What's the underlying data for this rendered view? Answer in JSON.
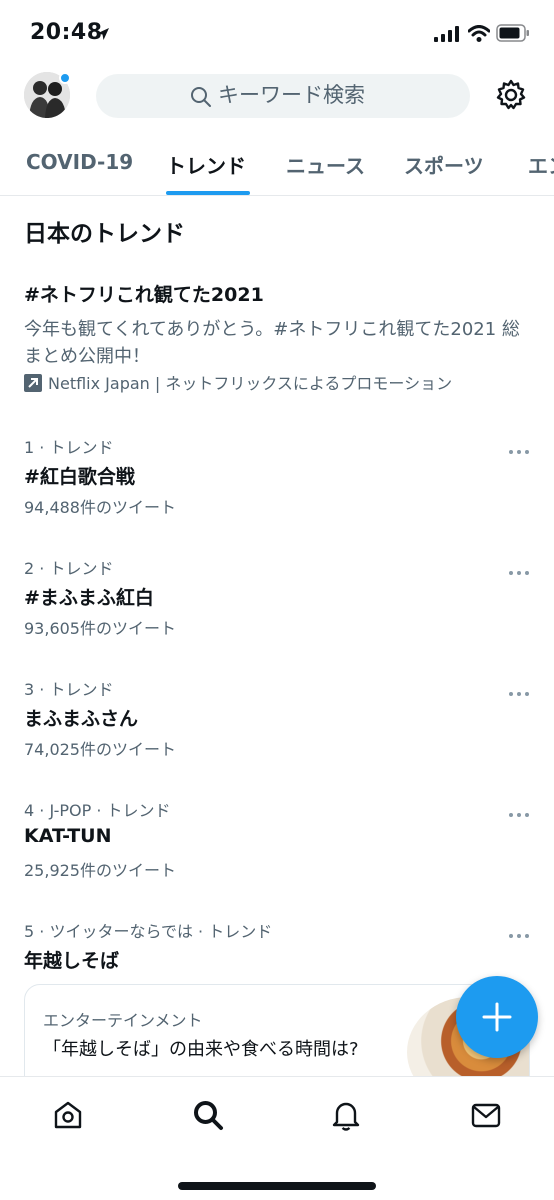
{
  "status_bar": {
    "time": "20:48"
  },
  "search": {
    "placeholder": "キーワード検索"
  },
  "tabs": [
    {
      "label": "COVID-19"
    },
    {
      "label": "トレンド"
    },
    {
      "label": "ニュース"
    },
    {
      "label": "スポーツ"
    },
    {
      "label": "エン"
    }
  ],
  "section_title": "日本のトレンド",
  "promo": {
    "title": "#ネトフリこれ観てた2021",
    "description": "今年も観てくれてありがとう。#ネトフリこれ観てた2021 総まとめ公開中！",
    "promoted_by": "Netflix Japan | ネットフリックスによるプロモーション"
  },
  "trends": [
    {
      "meta": "1 · トレンド",
      "name": "#紅白歌合戦",
      "count": "94,488件のツイート"
    },
    {
      "meta": "2 · トレンド",
      "name": "#まふまふ紅白",
      "count": "93,605件のツイート"
    },
    {
      "meta": "3 · トレンド",
      "name": "まふまふさん",
      "count": "74,025件のツイート"
    },
    {
      "meta": "4 · J-POP · トレンド",
      "name": "KAT-TUN",
      "count": "25,925件のツイート"
    },
    {
      "meta": "5 · ツイッターならでは · トレンド",
      "name": "年越しそば",
      "count": ""
    }
  ],
  "news_card": {
    "category": "エンターテインメント",
    "headline": "「年越しそば」の由来や食べる時間は?"
  },
  "bottom_nav": [
    "home-icon",
    "search-icon",
    "bell-icon",
    "mail-icon"
  ],
  "colors": {
    "accent": "#1d9bf0",
    "text": "#0f1419",
    "secondary": "#536471"
  }
}
